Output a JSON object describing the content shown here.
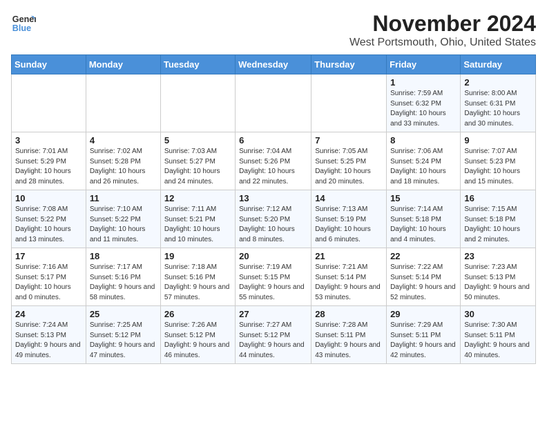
{
  "header": {
    "logo_line1": "General",
    "logo_line2": "Blue",
    "title": "November 2024",
    "subtitle": "West Portsmouth, Ohio, United States"
  },
  "days_of_week": [
    "Sunday",
    "Monday",
    "Tuesday",
    "Wednesday",
    "Thursday",
    "Friday",
    "Saturday"
  ],
  "weeks": [
    [
      {
        "day": "",
        "info": ""
      },
      {
        "day": "",
        "info": ""
      },
      {
        "day": "",
        "info": ""
      },
      {
        "day": "",
        "info": ""
      },
      {
        "day": "",
        "info": ""
      },
      {
        "day": "1",
        "info": "Sunrise: 7:59 AM\nSunset: 6:32 PM\nDaylight: 10 hours and 33 minutes."
      },
      {
        "day": "2",
        "info": "Sunrise: 8:00 AM\nSunset: 6:31 PM\nDaylight: 10 hours and 30 minutes."
      }
    ],
    [
      {
        "day": "3",
        "info": "Sunrise: 7:01 AM\nSunset: 5:29 PM\nDaylight: 10 hours and 28 minutes."
      },
      {
        "day": "4",
        "info": "Sunrise: 7:02 AM\nSunset: 5:28 PM\nDaylight: 10 hours and 26 minutes."
      },
      {
        "day": "5",
        "info": "Sunrise: 7:03 AM\nSunset: 5:27 PM\nDaylight: 10 hours and 24 minutes."
      },
      {
        "day": "6",
        "info": "Sunrise: 7:04 AM\nSunset: 5:26 PM\nDaylight: 10 hours and 22 minutes."
      },
      {
        "day": "7",
        "info": "Sunrise: 7:05 AM\nSunset: 5:25 PM\nDaylight: 10 hours and 20 minutes."
      },
      {
        "day": "8",
        "info": "Sunrise: 7:06 AM\nSunset: 5:24 PM\nDaylight: 10 hours and 18 minutes."
      },
      {
        "day": "9",
        "info": "Sunrise: 7:07 AM\nSunset: 5:23 PM\nDaylight: 10 hours and 15 minutes."
      }
    ],
    [
      {
        "day": "10",
        "info": "Sunrise: 7:08 AM\nSunset: 5:22 PM\nDaylight: 10 hours and 13 minutes."
      },
      {
        "day": "11",
        "info": "Sunrise: 7:10 AM\nSunset: 5:22 PM\nDaylight: 10 hours and 11 minutes."
      },
      {
        "day": "12",
        "info": "Sunrise: 7:11 AM\nSunset: 5:21 PM\nDaylight: 10 hours and 10 minutes."
      },
      {
        "day": "13",
        "info": "Sunrise: 7:12 AM\nSunset: 5:20 PM\nDaylight: 10 hours and 8 minutes."
      },
      {
        "day": "14",
        "info": "Sunrise: 7:13 AM\nSunset: 5:19 PM\nDaylight: 10 hours and 6 minutes."
      },
      {
        "day": "15",
        "info": "Sunrise: 7:14 AM\nSunset: 5:18 PM\nDaylight: 10 hours and 4 minutes."
      },
      {
        "day": "16",
        "info": "Sunrise: 7:15 AM\nSunset: 5:18 PM\nDaylight: 10 hours and 2 minutes."
      }
    ],
    [
      {
        "day": "17",
        "info": "Sunrise: 7:16 AM\nSunset: 5:17 PM\nDaylight: 10 hours and 0 minutes."
      },
      {
        "day": "18",
        "info": "Sunrise: 7:17 AM\nSunset: 5:16 PM\nDaylight: 9 hours and 58 minutes."
      },
      {
        "day": "19",
        "info": "Sunrise: 7:18 AM\nSunset: 5:16 PM\nDaylight: 9 hours and 57 minutes."
      },
      {
        "day": "20",
        "info": "Sunrise: 7:19 AM\nSunset: 5:15 PM\nDaylight: 9 hours and 55 minutes."
      },
      {
        "day": "21",
        "info": "Sunrise: 7:21 AM\nSunset: 5:14 PM\nDaylight: 9 hours and 53 minutes."
      },
      {
        "day": "22",
        "info": "Sunrise: 7:22 AM\nSunset: 5:14 PM\nDaylight: 9 hours and 52 minutes."
      },
      {
        "day": "23",
        "info": "Sunrise: 7:23 AM\nSunset: 5:13 PM\nDaylight: 9 hours and 50 minutes."
      }
    ],
    [
      {
        "day": "24",
        "info": "Sunrise: 7:24 AM\nSunset: 5:13 PM\nDaylight: 9 hours and 49 minutes."
      },
      {
        "day": "25",
        "info": "Sunrise: 7:25 AM\nSunset: 5:12 PM\nDaylight: 9 hours and 47 minutes."
      },
      {
        "day": "26",
        "info": "Sunrise: 7:26 AM\nSunset: 5:12 PM\nDaylight: 9 hours and 46 minutes."
      },
      {
        "day": "27",
        "info": "Sunrise: 7:27 AM\nSunset: 5:12 PM\nDaylight: 9 hours and 44 minutes."
      },
      {
        "day": "28",
        "info": "Sunrise: 7:28 AM\nSunset: 5:11 PM\nDaylight: 9 hours and 43 minutes."
      },
      {
        "day": "29",
        "info": "Sunrise: 7:29 AM\nSunset: 5:11 PM\nDaylight: 9 hours and 42 minutes."
      },
      {
        "day": "30",
        "info": "Sunrise: 7:30 AM\nSunset: 5:11 PM\nDaylight: 9 hours and 40 minutes."
      }
    ]
  ]
}
